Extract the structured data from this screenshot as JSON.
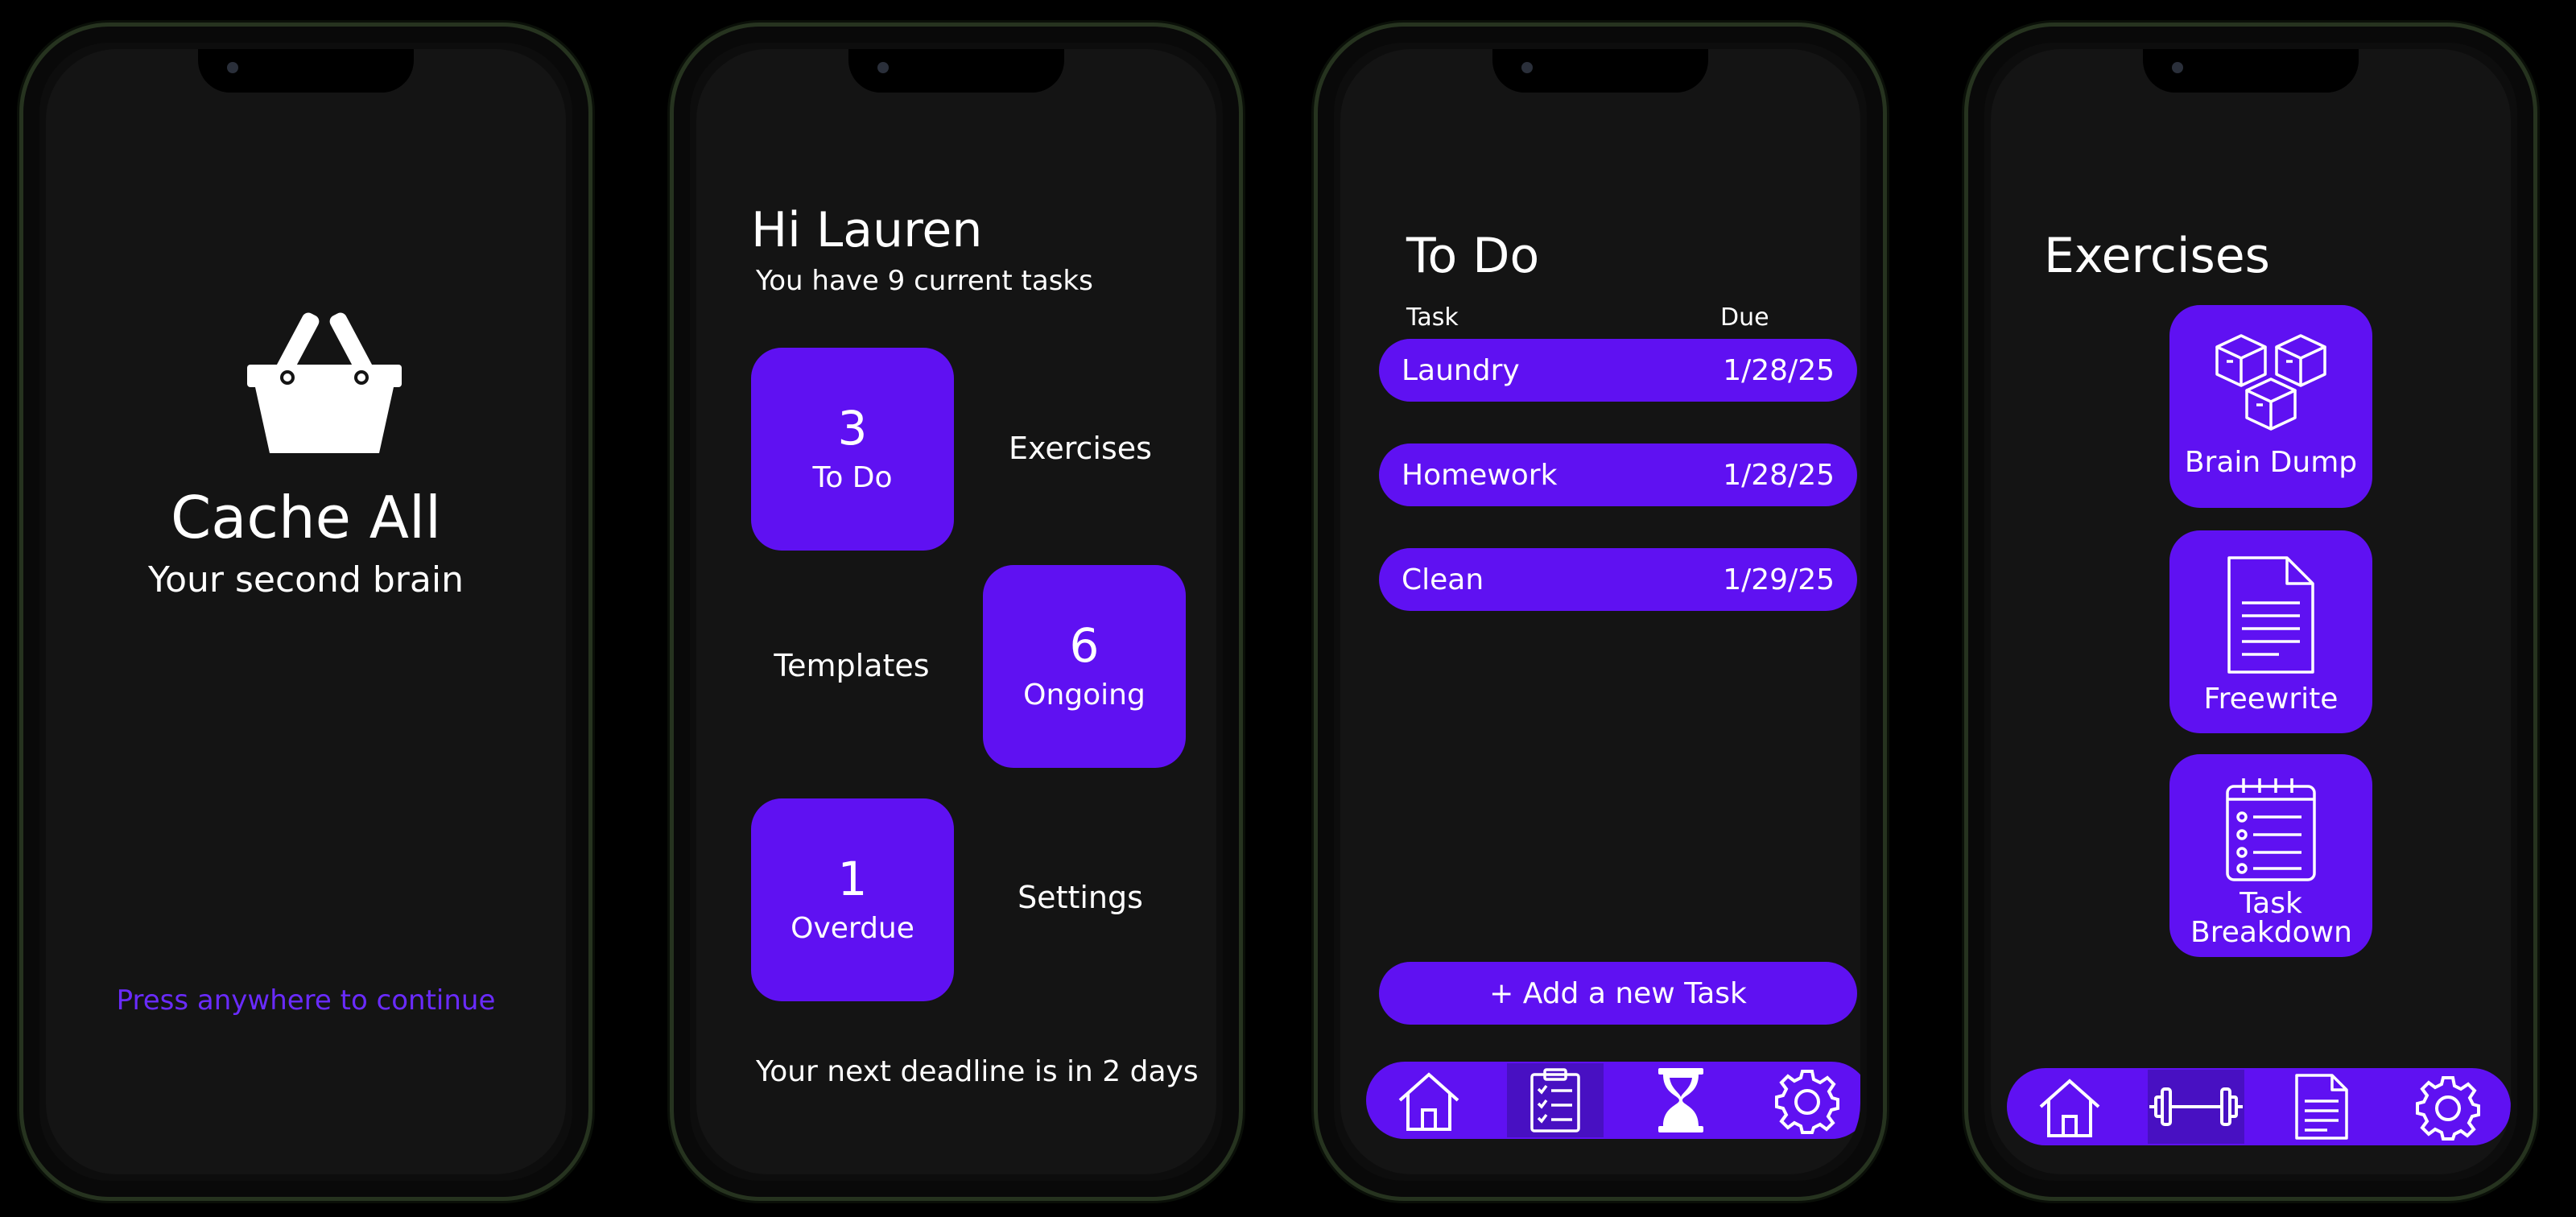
{
  "accent": "#5f11f2",
  "splash": {
    "title": "Cache All",
    "subtitle": "Your second brain",
    "continue": "Press anywhere to continue",
    "logo_icon": "basket-icon"
  },
  "home": {
    "greeting": "Hi Lauren",
    "summary": "You have 9 current tasks",
    "todo": {
      "count": "3",
      "label": "To Do"
    },
    "exercises": "Exercises",
    "templates": "Templates",
    "ongoing": {
      "count": "6",
      "label": "Ongoing"
    },
    "overdue": {
      "count": "1",
      "label": "Overdue"
    },
    "settings": "Settings",
    "deadline": "Your next deadline is in 2 days"
  },
  "todo": {
    "title": "To Do",
    "col_task": "Task",
    "col_due": "Due",
    "tasks": [
      {
        "name": "Laundry",
        "due": "1/28/25"
      },
      {
        "name": "Homework",
        "due": "1/28/25"
      },
      {
        "name": "Clean",
        "due": "1/29/25"
      }
    ],
    "add_button": "+ Add a new Task",
    "nav": [
      "home-icon",
      "clipboard-checklist-icon",
      "hourglass-icon",
      "gear-icon"
    ],
    "active_nav": "clipboard-checklist-icon"
  },
  "exercises": {
    "title": "Exercises",
    "items": [
      {
        "label": "Brain Dump",
        "icon": "boxes-icon"
      },
      {
        "label": "Freewrite",
        "icon": "document-icon"
      },
      {
        "label": "Task Breakdown",
        "icon": "notepad-list-icon"
      }
    ],
    "nav": [
      "home-icon",
      "dumbbell-icon",
      "document-icon",
      "gear-icon"
    ],
    "active_nav": "dumbbell-icon"
  }
}
